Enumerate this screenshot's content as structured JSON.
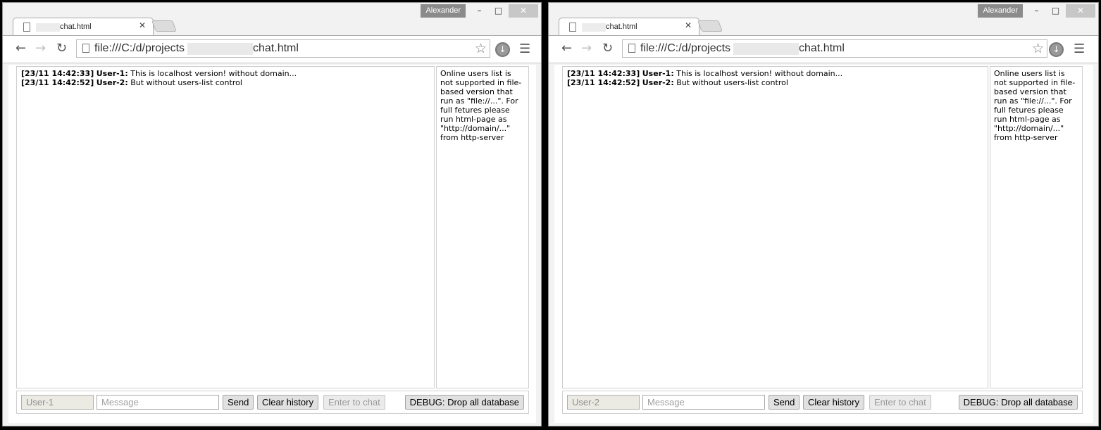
{
  "windows": [
    {
      "profile_name": "Alexander",
      "tab_title": "chat.html",
      "url_start": "file:///C:/d/projects",
      "url_end": "chat.html",
      "messages": [
        {
          "time": "[23/11 14:42:33]",
          "user": "User-1:",
          "text": "This is localhost version! without domain..."
        },
        {
          "time": "[23/11 14:42:52]",
          "user": "User-2:",
          "text": "But without users-list control"
        }
      ],
      "users_panel_text": "Online users list is not supported in file-based version that run as \"file://...\". For full fetures please run html-page as \"http://domain/...\" from http-server",
      "name_value": "User-1",
      "message_placeholder": "Message",
      "send_label": "Send",
      "clear_label": "Clear history",
      "enter_label": "Enter to chat",
      "debug_label": "DEBUG: Drop all database"
    },
    {
      "profile_name": "Alexander",
      "tab_title": "chat.html",
      "url_start": "file:///C:/d/projects",
      "url_end": "chat.html",
      "messages": [
        {
          "time": "[23/11 14:42:33]",
          "user": "User-1:",
          "text": "This is localhost version! without domain..."
        },
        {
          "time": "[23/11 14:42:52]",
          "user": "User-2:",
          "text": "But without users-list control"
        }
      ],
      "users_panel_text": "Online users list is not supported in file-based version that run as \"file://...\". For full fetures please run html-page as \"http://domain/...\" from http-server",
      "name_value": "User-2",
      "message_placeholder": "Message",
      "send_label": "Send",
      "clear_label": "Clear history",
      "enter_label": "Enter to chat",
      "debug_label": "DEBUG: Drop all database"
    }
  ]
}
